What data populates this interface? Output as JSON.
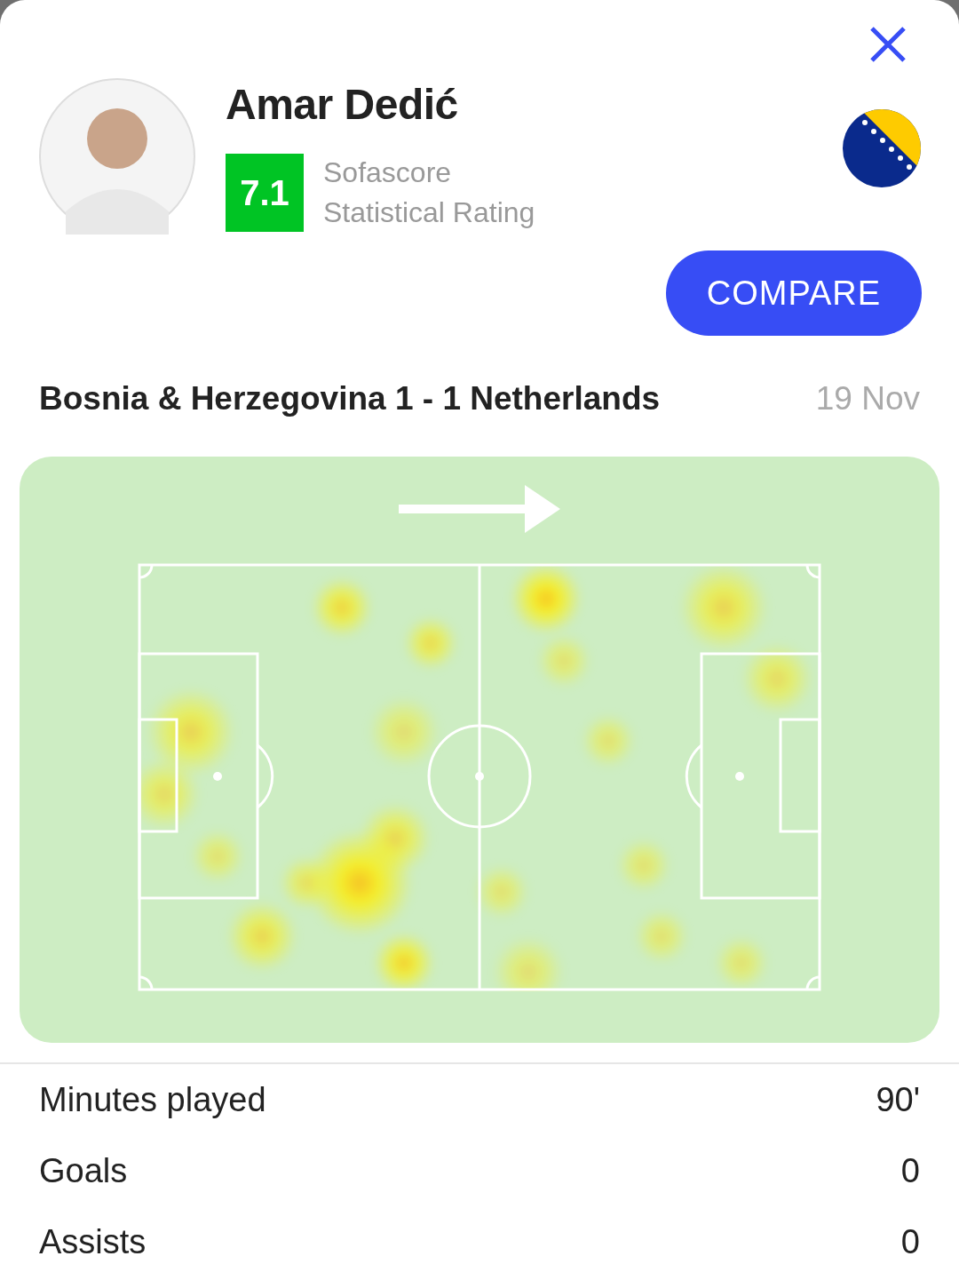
{
  "player": {
    "name": "Amar Dedić",
    "rating": "7.1",
    "rating_source": "Sofascore",
    "rating_label": "Statistical Rating"
  },
  "compare_button": "COMPARE",
  "match": {
    "title": "Bosnia & Herzegovina 1 - 1 Netherlands",
    "date": "19 Nov"
  },
  "stats": [
    {
      "label": "Minutes played",
      "value": "90'"
    },
    {
      "label": "Goals",
      "value": "0"
    },
    {
      "label": "Assists",
      "value": "0"
    }
  ]
}
